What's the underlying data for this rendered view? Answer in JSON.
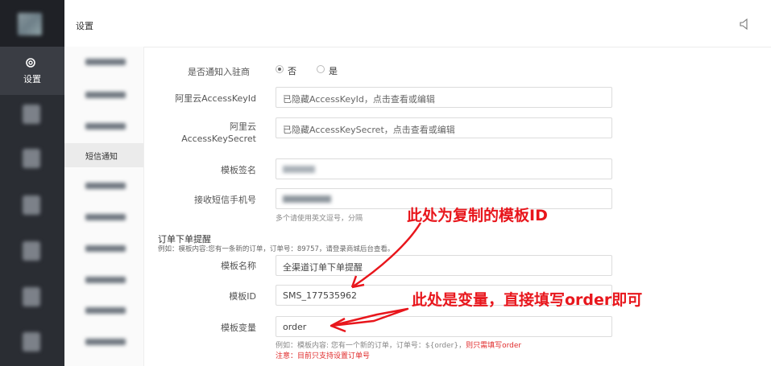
{
  "header": {
    "title": "设置"
  },
  "nav": {
    "active_label": "设置"
  },
  "sub_menu": {
    "selected": "短信通知"
  },
  "form": {
    "notify_merchant": {
      "label": "是否通知入驻商",
      "options": [
        "否",
        "是"
      ],
      "selected": "否"
    },
    "access_key_id": {
      "label": "阿里云AccessKeyId",
      "placeholder": "已隐藏AccessKeyId，点击查看或编辑"
    },
    "access_key_secret": {
      "label_line1": "阿里云",
      "label_line2": "AccessKeySecret",
      "placeholder": "已隐藏AccessKeySecret，点击查看或编辑"
    },
    "template_sign": {
      "label": "模板签名"
    },
    "phone": {
      "label": "接收短信手机号",
      "help": "多个请使用英文逗号，分隔"
    },
    "order_section": {
      "title": "订单下单提醒",
      "example": "例如：模板内容:您有一条新的订单，订单号：89757，请登录商城后台查看。",
      "template_name": {
        "label": "模板名称",
        "value": "全渠道订单下单提醒"
      },
      "template_id": {
        "label": "模板ID",
        "value": "SMS_177535962"
      },
      "template_var": {
        "label": "模板变量",
        "value": "order",
        "help_prefix": "例如：模板内容: 您有一个新的订单，订单号：${order}，",
        "help_red": "则只需填写order",
        "note": "注意：目前只支持设置订单号"
      }
    }
  },
  "annotations": {
    "template_id_note": "此处为复制的模板ID",
    "variable_note": "此处是变量，直接填写order即可"
  },
  "colors": {
    "annotation": "#e8161c",
    "nav_bg": "#2a2d33"
  }
}
